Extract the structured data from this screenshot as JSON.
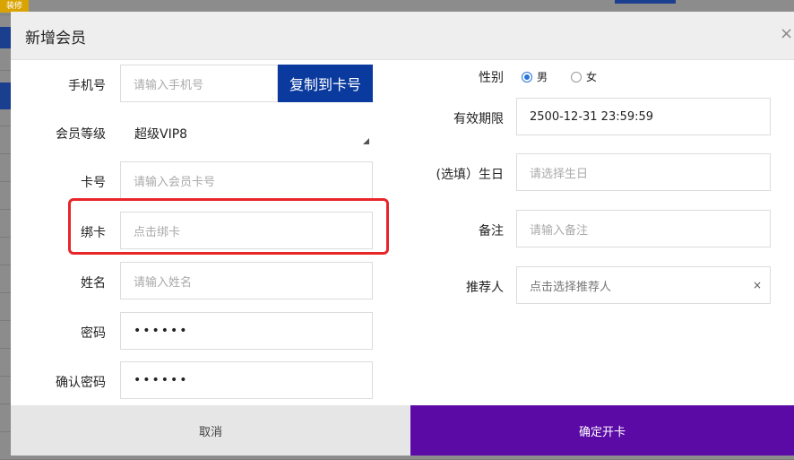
{
  "background": {
    "badge": "装修"
  },
  "dialog": {
    "title": "新增会员",
    "close": "×"
  },
  "left": {
    "phone": {
      "label": "手机号",
      "placeholder": "请输入手机号",
      "copy_button": "复制到卡号"
    },
    "level": {
      "label": "会员等级",
      "value": "超级VIP8"
    },
    "card_no": {
      "label": "卡号",
      "placeholder": "请输入会员卡号"
    },
    "bind_card": {
      "label": "绑卡",
      "placeholder": "点击绑卡"
    },
    "name": {
      "label": "姓名",
      "placeholder": "请输入姓名"
    },
    "password": {
      "label": "密码",
      "value": "••••••"
    },
    "confirm_password": {
      "label": "确认密码",
      "value": "••••••"
    }
  },
  "right": {
    "gender": {
      "label": "性别",
      "options": [
        "男",
        "女"
      ],
      "selected": "男"
    },
    "expiry": {
      "label": "有效期限",
      "value": "2500-12-31 23:59:59"
    },
    "birthday": {
      "label": "(选填）生日",
      "placeholder": "请选择生日"
    },
    "remark": {
      "label": "备注",
      "placeholder": "请输入备注"
    },
    "referrer": {
      "label": "推荐人",
      "placeholder": "点击选择推荐人",
      "clear": "×"
    }
  },
  "footer": {
    "cancel": "取消",
    "confirm": "确定开卡"
  },
  "colors": {
    "primary": "#5b0aa6",
    "copy_button": "#0b3a9e",
    "highlight": "#e8262a",
    "radio": "#2a73d9"
  }
}
